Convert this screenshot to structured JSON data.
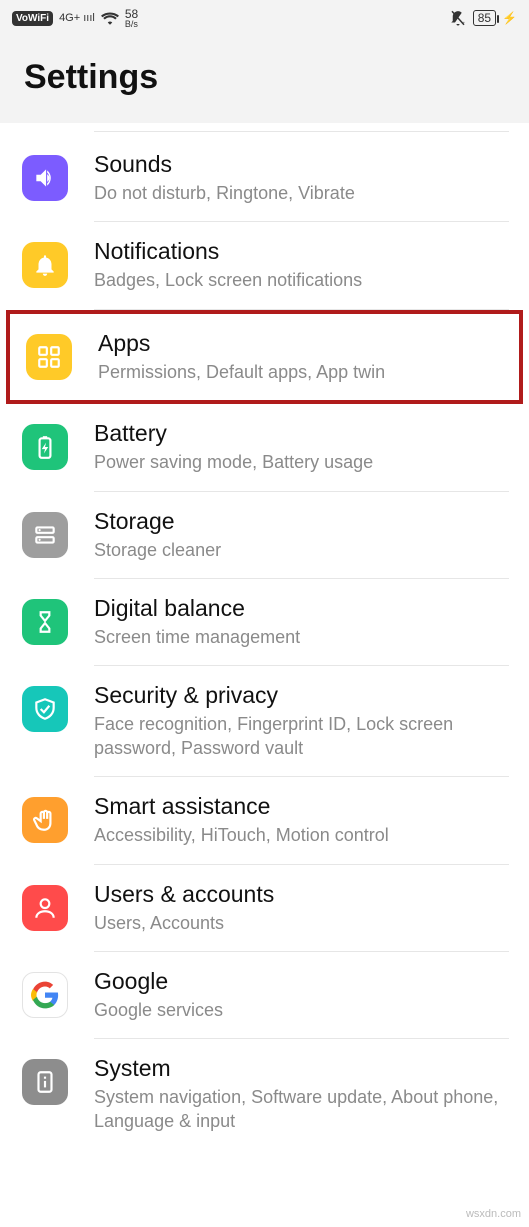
{
  "statusbar": {
    "vowifi": "VoWiFi",
    "signal_label": "4G+",
    "net_rate_top": "58",
    "net_rate_bottom": "B/s",
    "battery_percent": "85"
  },
  "header": {
    "title": "Settings"
  },
  "items": [
    {
      "id": "sounds",
      "title": "Sounds",
      "subtitle": "Do not disturb, Ringtone, Vibrate",
      "icon": "sound-icon",
      "bg": "bg-purple"
    },
    {
      "id": "notifications",
      "title": "Notifications",
      "subtitle": "Badges, Lock screen notifications",
      "icon": "bell-icon",
      "bg": "bg-yellow"
    },
    {
      "id": "apps",
      "title": "Apps",
      "subtitle": "Permissions, Default apps, App twin",
      "icon": "apps-icon",
      "bg": "bg-yellow",
      "highlight": true
    },
    {
      "id": "battery",
      "title": "Battery",
      "subtitle": "Power saving mode, Battery usage",
      "icon": "battery-icon",
      "bg": "bg-green"
    },
    {
      "id": "storage",
      "title": "Storage",
      "subtitle": "Storage cleaner",
      "icon": "storage-icon",
      "bg": "bg-gray"
    },
    {
      "id": "digital",
      "title": "Digital balance",
      "subtitle": "Screen time management",
      "icon": "hourglass-icon",
      "bg": "bg-green"
    },
    {
      "id": "security",
      "title": "Security & privacy",
      "subtitle": "Face recognition, Fingerprint ID, Lock screen password, Password vault",
      "icon": "shield-icon",
      "bg": "bg-teal"
    },
    {
      "id": "smart",
      "title": "Smart assistance",
      "subtitle": "Accessibility, HiTouch, Motion control",
      "icon": "hand-icon",
      "bg": "bg-orange"
    },
    {
      "id": "users",
      "title": "Users & accounts",
      "subtitle": "Users, Accounts",
      "icon": "user-icon",
      "bg": "bg-red"
    },
    {
      "id": "google",
      "title": "Google",
      "subtitle": "Google services",
      "icon": "google-icon",
      "bg": "bg-white"
    },
    {
      "id": "system",
      "title": "System",
      "subtitle": "System navigation, Software update, About phone, Language & input",
      "icon": "info-icon",
      "bg": "bg-dgray"
    }
  ],
  "watermark": "wsxdn.com"
}
